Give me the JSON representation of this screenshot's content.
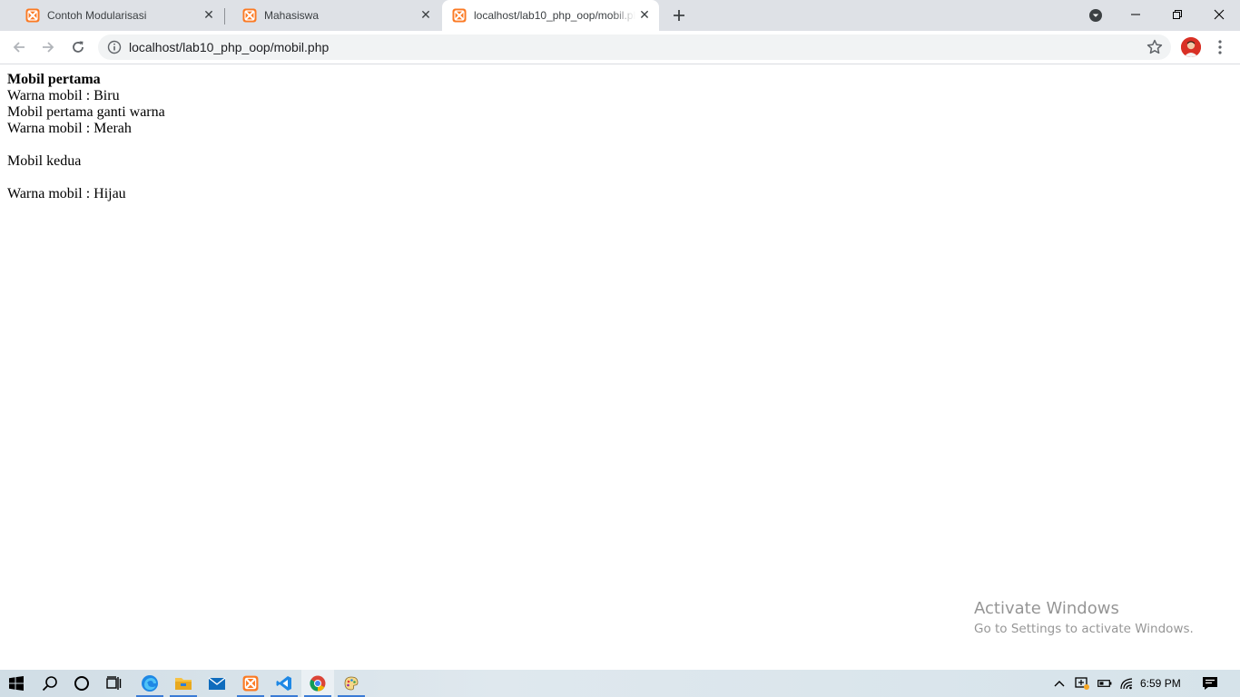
{
  "browser": {
    "tabs": [
      {
        "title": "Contoh Modularisasi",
        "active": false
      },
      {
        "title": "Mahasiswa",
        "active": false
      },
      {
        "title": "localhost/lab10_php_oop/mobil.php",
        "active": true
      }
    ],
    "address_bar": {
      "url": "localhost/lab10_php_oop/mobil.php"
    },
    "accent_color": "#e8710a"
  },
  "page": {
    "lines": [
      {
        "text": "Mobil pertama",
        "bold": true
      },
      {
        "text": "Warna mobil : Biru"
      },
      {
        "text": "Mobil pertama ganti warna"
      },
      {
        "text": "Warna mobil : Merah"
      },
      {
        "text": "Mobil kedua"
      },
      {
        "text": "Warna mobil : Hijau"
      }
    ]
  },
  "watermark": {
    "title": "Activate Windows",
    "subtitle": "Go to Settings to activate Windows."
  },
  "taskbar": {
    "apps": [
      "start-icon",
      "search-icon",
      "cortana-icon",
      "task-view-icon",
      "edge-icon",
      "file-explorer-icon",
      "mail-icon",
      "xampp-icon",
      "vscode-icon",
      "chrome-icon",
      "paint-icon"
    ],
    "clock": "6:59 PM"
  }
}
